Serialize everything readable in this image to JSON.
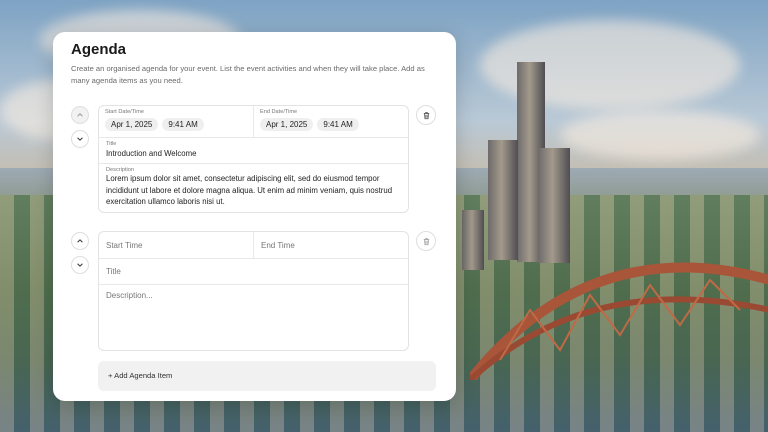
{
  "agenda": {
    "title": "Agenda",
    "description": "Create an organised agenda for your event. List the event activities and when they will take place. Add as many agenda items as you need."
  },
  "items": [
    {
      "start_label": "Start Date/Time",
      "start_date": "Apr 1, 2025",
      "start_time": "9:41 AM",
      "end_label": "End Date/Time",
      "end_date": "Apr 1, 2025",
      "end_time": "9:41 AM",
      "title_label": "Title",
      "title": "Introduction and Welcome",
      "description_label": "Description",
      "description": "Lorem ipsum dolor sit amet, consectetur adipiscing elit, sed do eiusmod tempor incididunt ut labore et dolore magna aliqua. Ut enim ad minim veniam, quis nostrud exercitation ullamco laboris nisi ut."
    },
    {
      "start_placeholder": "Start Time",
      "end_placeholder": "End Time",
      "title_placeholder": "Title",
      "description_placeholder": "Description..."
    }
  ],
  "add_button_label": "+ Add Agenda Item",
  "icons": {
    "up": "chevron-up-icon",
    "down": "chevron-down-icon",
    "delete": "trash-icon"
  }
}
